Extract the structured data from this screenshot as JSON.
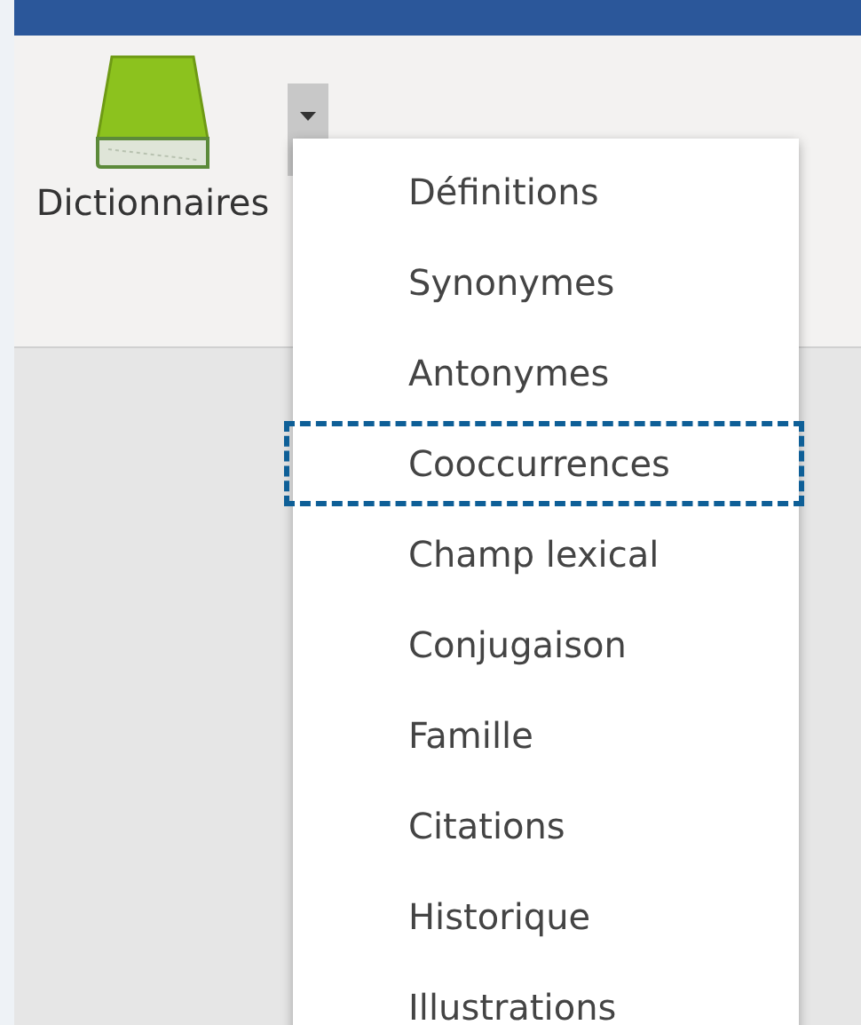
{
  "ribbon": {
    "button": {
      "label": "Dictionnaires"
    }
  },
  "menu": {
    "items": [
      {
        "label": "Définitions",
        "selected": false
      },
      {
        "label": "Synonymes",
        "selected": false
      },
      {
        "label": "Antonymes",
        "selected": false
      },
      {
        "label": "Cooccurrences",
        "selected": true
      },
      {
        "label": "Champ lexical",
        "selected": false
      },
      {
        "label": "Conjugaison",
        "selected": false
      },
      {
        "label": "Famille",
        "selected": false
      },
      {
        "label": "Citations",
        "selected": false
      },
      {
        "label": "Historique",
        "selected": false
      },
      {
        "label": "Illustrations",
        "selected": false
      }
    ]
  }
}
